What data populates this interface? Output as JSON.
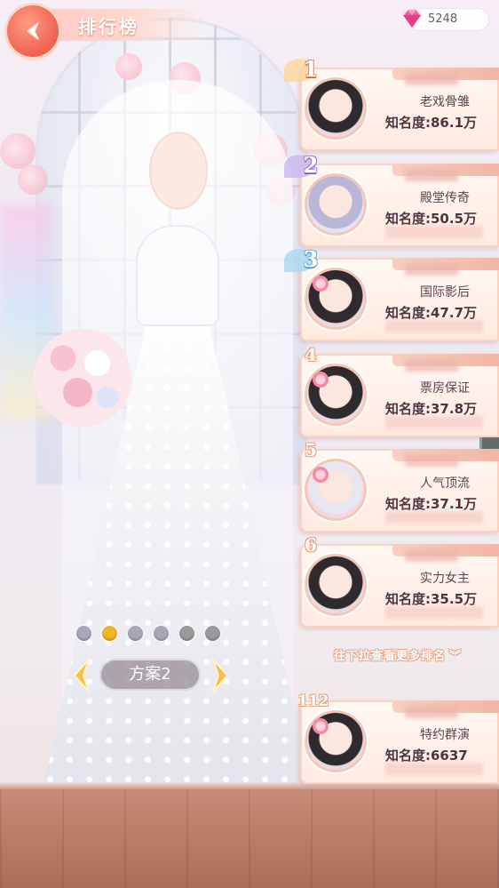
{
  "header": {
    "title": "排行榜"
  },
  "currency": {
    "icon": "gem-icon",
    "value": "5248"
  },
  "outfit": {
    "scheme_label": "方案2",
    "dots": [
      {
        "color": "#a9a7b6"
      },
      {
        "color": "#f0b62a"
      },
      {
        "color": "#a9a7b6"
      },
      {
        "color": "#a9a7b6"
      },
      {
        "color": "#9a9a9a"
      },
      {
        "color": "#9a9a9a"
      }
    ]
  },
  "ranking": {
    "items": [
      {
        "rank": "1",
        "title": "老戏骨雏",
        "fame": "知名度:86.1万",
        "badge": "gold"
      },
      {
        "rank": "2",
        "title": "殿堂传奇",
        "fame": "知名度:50.5万",
        "badge": "purple"
      },
      {
        "rank": "3",
        "title": "国际影后",
        "fame": "知名度:47.7万",
        "badge": "blue"
      },
      {
        "rank": "4",
        "title": "票房保证",
        "fame": "知名度:37.8万",
        "badge": "plain"
      },
      {
        "rank": "5",
        "title": "人气顶流",
        "fame": "知名度:37.1万",
        "badge": "plain"
      },
      {
        "rank": "6",
        "title": "实力女主",
        "fame": "知名度:35.5万",
        "badge": "plain"
      }
    ],
    "more_hint": "往下拉查看更多排名",
    "self": {
      "rank": "112",
      "title": "特约群演",
      "fame": "知名度:6637"
    }
  }
}
